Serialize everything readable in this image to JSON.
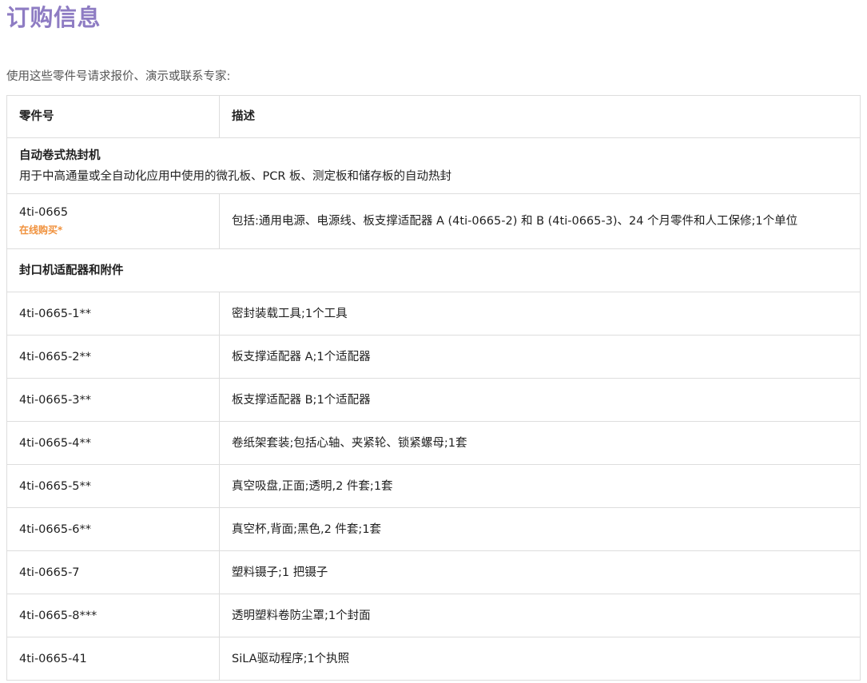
{
  "page": {
    "title": "订购信息",
    "intro": "使用这些零件号请求报价、演示或联系专家:"
  },
  "table": {
    "headers": {
      "part_number": "零件号",
      "description": "描述"
    },
    "section1": {
      "title": "自动卷式热封机",
      "description": "用于中高通量或全自动化应用中使用的微孔板、PCR 板、测定板和储存板的自动热封"
    },
    "product": {
      "part": "4ti-0665",
      "buy_label": "在线购买*",
      "description": "包括:通用电源、电源线、板支撑适配器 A (4ti-0665-2) 和 B (4ti-0665-3)、24 个月零件和人工保修;1个单位"
    },
    "section2": {
      "title": "封口机适配器和附件"
    },
    "rows": [
      {
        "part": "4ti-0665-1**",
        "description": "密封装载工具;1个工具"
      },
      {
        "part": "4ti-0665-2**",
        "description": "板支撑适配器 A;1个适配器"
      },
      {
        "part": "4ti-0665-3**",
        "description": "板支撑适配器 B;1个适配器"
      },
      {
        "part": "4ti-0665-4**",
        "description": "卷纸架套装;包括心轴、夹紧轮、锁紧螺母;1套"
      },
      {
        "part": "4ti-0665-5**",
        "description": "真空吸盘,正面;透明,2 件套;1套"
      },
      {
        "part": "4ti-0665-6**",
        "description": "真空杯,背面;黑色,2 件套;1套"
      },
      {
        "part": "4ti-0665-7",
        "description": "塑料镊子;1 把镊子"
      },
      {
        "part": "4ti-0665-8***",
        "description": "透明塑料卷防尘罩;1个封面"
      },
      {
        "part": "4ti-0665-41",
        "description": "SiLA驱动程序;1个执照"
      }
    ]
  },
  "colors": {
    "title": "#8e7cc3",
    "buy_link": "#f0913c",
    "border": "#dddddd"
  }
}
